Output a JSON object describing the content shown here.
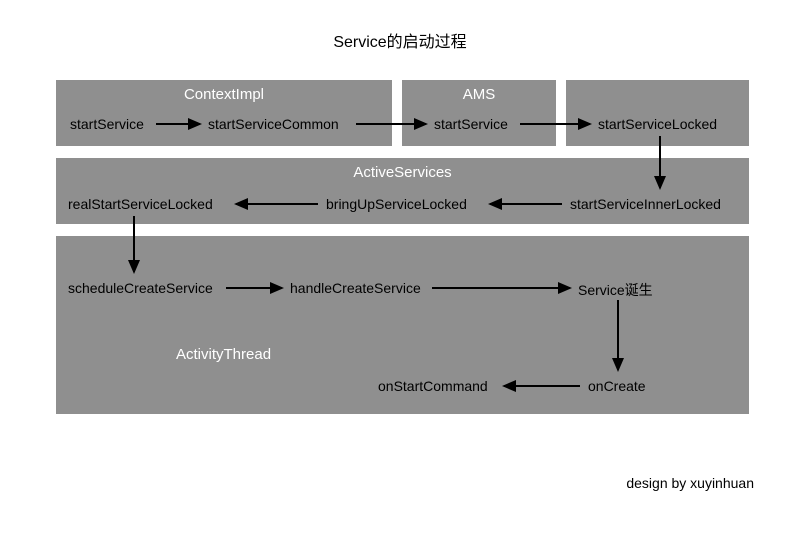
{
  "title": "Service的启动过程",
  "credit": "design by xuyinhuan",
  "boxes": {
    "contextImpl": {
      "label": "ContextImpl"
    },
    "ams": {
      "label": "AMS"
    },
    "activeServices": {
      "label": "ActiveServices"
    },
    "activityThread": {
      "label": "ActivityThread"
    }
  },
  "nodes": {
    "startService1": "startService",
    "startServiceCommon": "startServiceCommon",
    "startService2": "startService",
    "startServiceLocked": "startServiceLocked",
    "startServiceInnerLocked": "startServiceInnerLocked",
    "bringUpServiceLocked": "bringUpServiceLocked",
    "realStartServiceLocked": "realStartServiceLocked",
    "scheduleCreateService": "scheduleCreateService",
    "handleCreateService": "handleCreateService",
    "serviceBorn": "Service诞生",
    "onCreate": "onCreate",
    "onStartCommand": "onStartCommand"
  },
  "chart_data": {
    "type": "flowchart",
    "title": "Service的启动过程",
    "groups": [
      {
        "name": "ContextImpl",
        "nodes": [
          "startService",
          "startServiceCommon"
        ]
      },
      {
        "name": "AMS",
        "nodes": [
          "startService"
        ]
      },
      {
        "name": "ActiveServices",
        "nodes": [
          "startServiceLocked",
          "startServiceInnerLocked",
          "bringUpServiceLocked",
          "realStartServiceLocked"
        ]
      },
      {
        "name": "ActivityThread",
        "nodes": [
          "scheduleCreateService",
          "handleCreateService",
          "Service诞生",
          "onCreate",
          "onStartCommand"
        ]
      }
    ],
    "edges": [
      [
        "ContextImpl.startService",
        "ContextImpl.startServiceCommon"
      ],
      [
        "ContextImpl.startServiceCommon",
        "AMS.startService"
      ],
      [
        "AMS.startService",
        "ActiveServices.startServiceLocked"
      ],
      [
        "ActiveServices.startServiceLocked",
        "ActiveServices.startServiceInnerLocked"
      ],
      [
        "ActiveServices.startServiceInnerLocked",
        "ActiveServices.bringUpServiceLocked"
      ],
      [
        "ActiveServices.bringUpServiceLocked",
        "ActiveServices.realStartServiceLocked"
      ],
      [
        "ActiveServices.realStartServiceLocked",
        "ActivityThread.scheduleCreateService"
      ],
      [
        "ActivityThread.scheduleCreateService",
        "ActivityThread.handleCreateService"
      ],
      [
        "ActivityThread.handleCreateService",
        "Service诞生"
      ],
      [
        "Service诞生",
        "onCreate"
      ],
      [
        "onCreate",
        "onStartCommand"
      ]
    ]
  }
}
